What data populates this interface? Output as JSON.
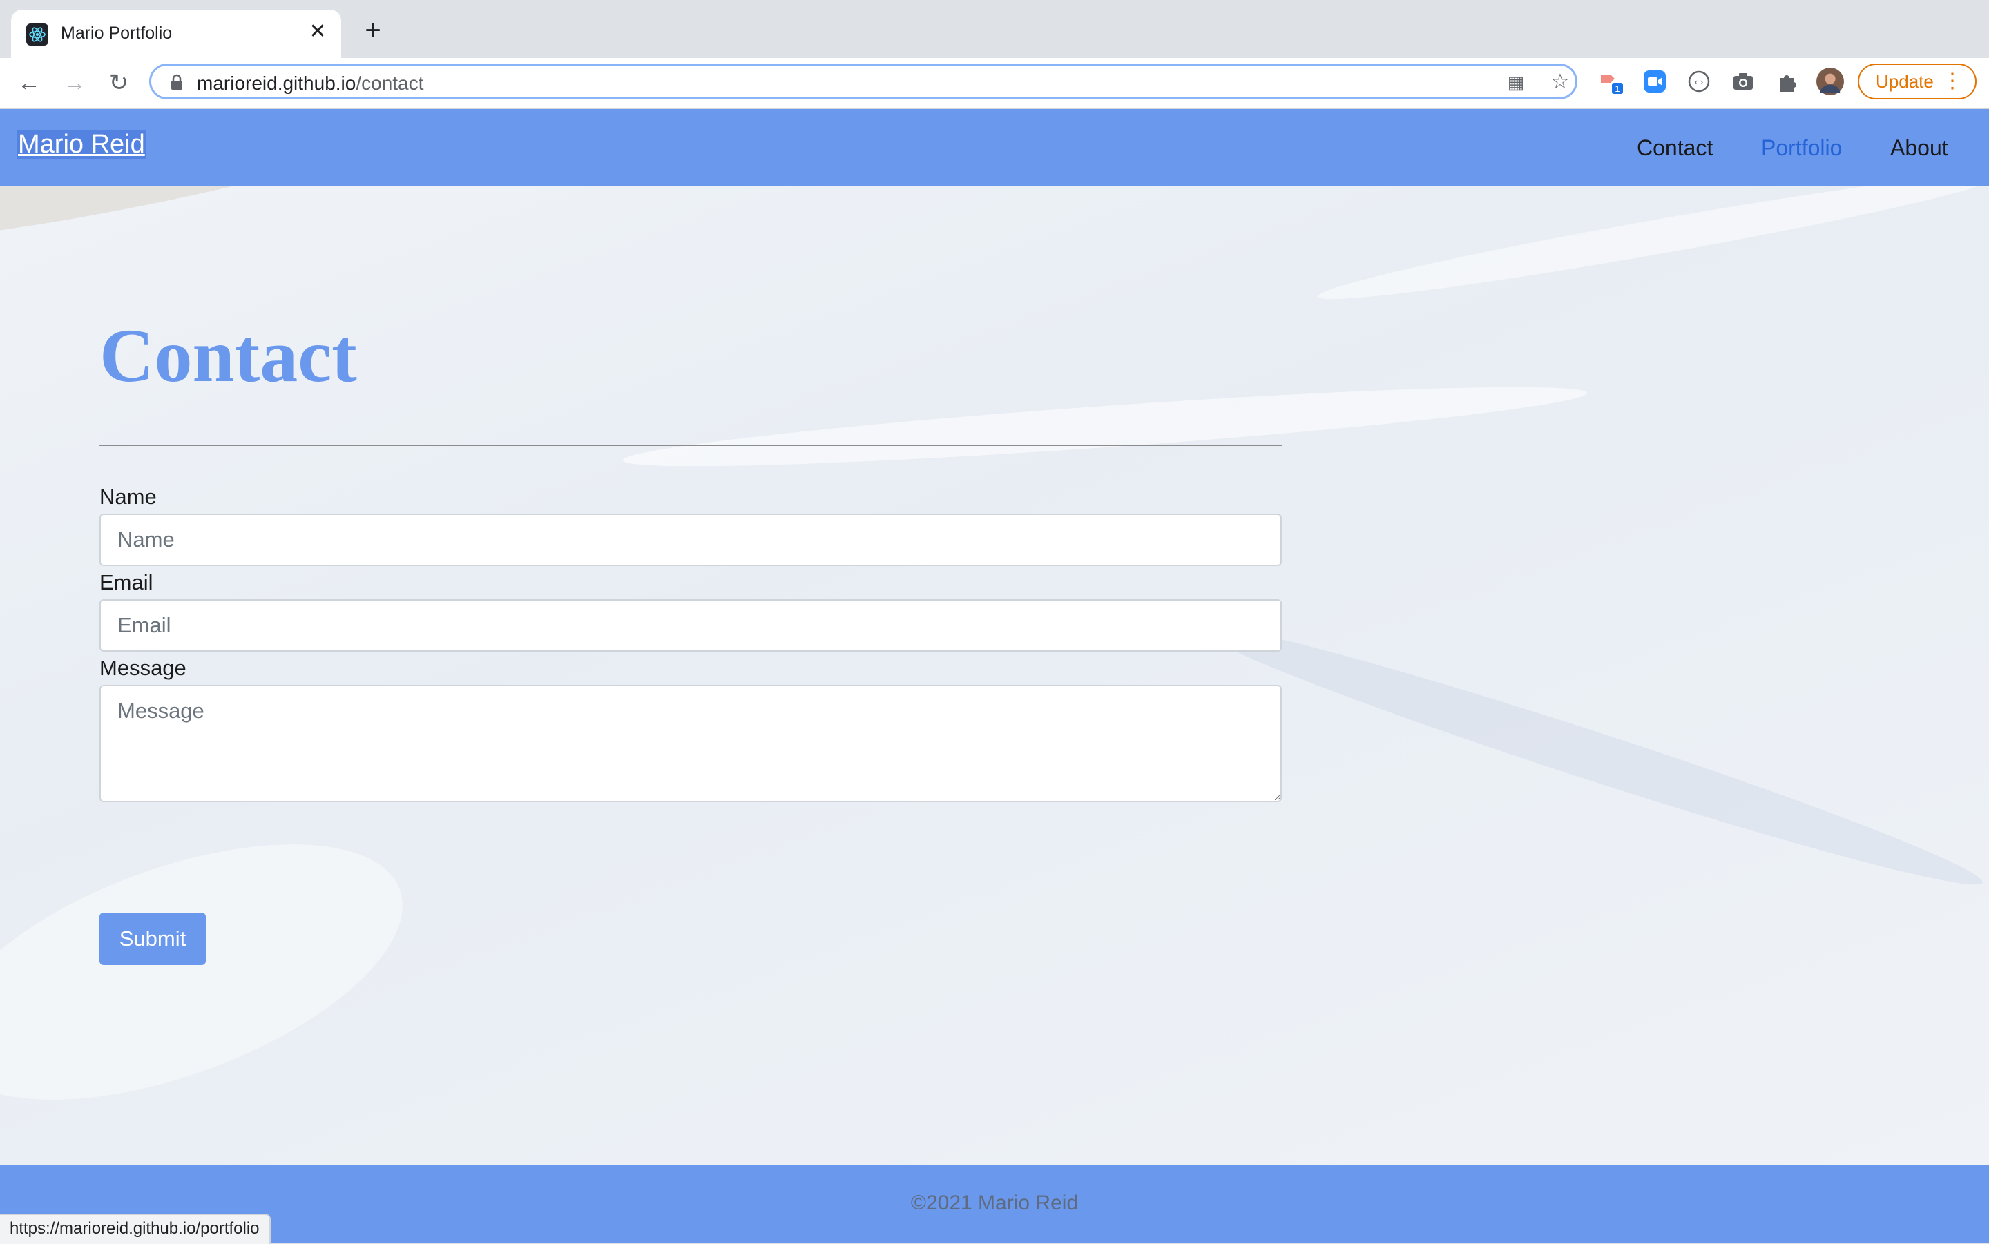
{
  "browser": {
    "tab_title": "Mario Portfolio",
    "url_host": "marioreid.github.io",
    "url_path": "/contact",
    "update_label": "Update",
    "extension_badge": "1",
    "status_url": "https://marioreid.github.io/portfolio"
  },
  "site": {
    "brand": "Mario Reid",
    "nav": [
      {
        "label": "Contact"
      },
      {
        "label": "Portfolio"
      },
      {
        "label": "About"
      }
    ],
    "accent": "#6a98ed"
  },
  "contact": {
    "title": "Contact",
    "name_label": "Name",
    "name_placeholder": "Name",
    "email_label": "Email",
    "email_placeholder": "Email",
    "message_label": "Message",
    "message_placeholder": "Message",
    "submit_label": "Submit"
  },
  "footer": {
    "copyright": "©2021 Mario Reid"
  }
}
